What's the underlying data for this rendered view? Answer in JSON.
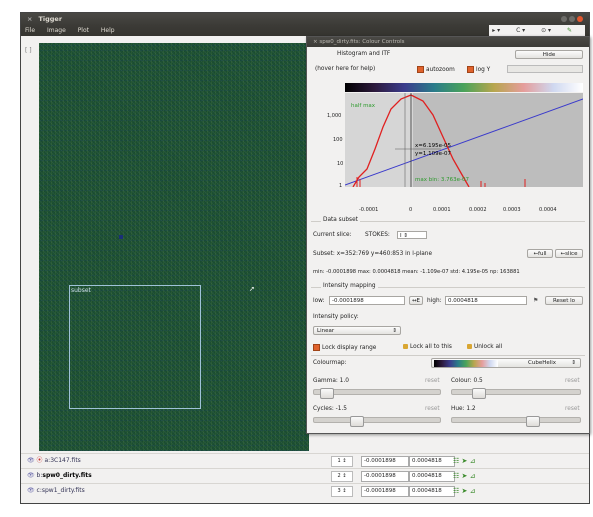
{
  "window": {
    "title": "Tigger",
    "menu": [
      "File",
      "Image",
      "Plot",
      "Help"
    ]
  },
  "canvas": {
    "subset_label": "subset"
  },
  "layers": [
    {
      "prefix": "a:",
      "name": "3C147.fits",
      "bold": false,
      "low": "-0.0001898",
      "high": "0.0004818"
    },
    {
      "prefix": "b:",
      "name": "spw0_dirty.fits",
      "bold": true,
      "low": "-0.0001898",
      "high": "0.0004818"
    },
    {
      "prefix": "c:",
      "name": "spw1_dirty.fits",
      "bold": false,
      "low": "-0.0001898",
      "high": "0.0004818"
    }
  ],
  "dialog": {
    "title": "spw0_dirty.fits: Colour Controls",
    "histogram": {
      "section": "Histogram and ITF",
      "hide_button": "Hide",
      "help_hint": "(hover here for help)",
      "autozoom": "autozoom",
      "logy": "log Y",
      "yticks": [
        "1,000",
        "100",
        "10",
        "1"
      ],
      "xticks": [
        "-0.0001",
        "0",
        "0.0001",
        "0.0002",
        "0.0003",
        "0.0004"
      ],
      "half_max": "half max",
      "annotation_x": "x=6.195e-05",
      "annotation_y": "y=1.109e-07",
      "max_bin": "max bin: 3.763e-07"
    },
    "data_subset": {
      "section": "Data subset",
      "current_slice": "Current slice:",
      "stokes": "STOKES:",
      "subset_text": "Subset: x=352:769 y=460:853 in l-plane",
      "full_button": "←full",
      "slice_button": "←slice",
      "stats": "min: -0.0001898  max: 0.0004818  mean: -1.109e-07  std: 4.195e-05  np: 163881"
    },
    "intensity": {
      "section": "Intensity mapping",
      "low_label": "low:",
      "low_value": "-0.0001898",
      "swap_button": "↔E",
      "high_label": "high:",
      "high_value": "0.0004818",
      "reset_button": "Reset lo",
      "policy_label": "Intensity policy:",
      "policy_value": "Linear",
      "lock_display": "Lock display range",
      "lock_all": "Lock all to this",
      "unlock_all": "Unlock all"
    },
    "colourmap": {
      "label": "Colourmap:",
      "value": "CubeHelix",
      "gamma": "Gamma: 1.0",
      "colour": "Colour: 0.5",
      "cycles": "Cycles: -1.5",
      "hue": "Hue: 1.2",
      "reset": "reset"
    }
  }
}
